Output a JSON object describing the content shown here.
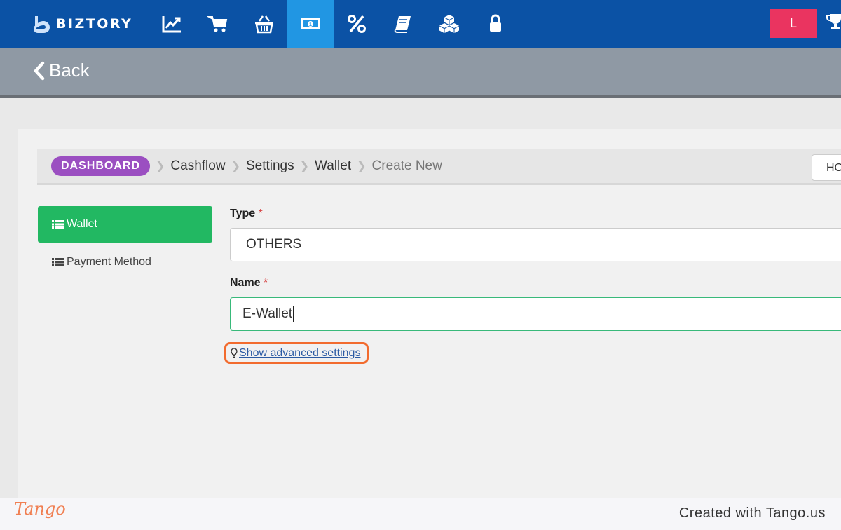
{
  "nav": {
    "brand": "BIZTORY",
    "icons": [
      "chart-line-icon",
      "cart-icon",
      "basket-icon",
      "money-icon",
      "percent-icon",
      "book-icon",
      "cubes-icon",
      "lock-icon"
    ],
    "active_icon": "money-icon",
    "user_initial": "L"
  },
  "back": {
    "label": "Back"
  },
  "breadcrumb": {
    "items": [
      "DASHBOARD",
      "Cashflow",
      "Settings",
      "Wallet",
      "Create New"
    ],
    "right_button_partial": "HO"
  },
  "sidebar": {
    "items": [
      {
        "label": "Wallet",
        "active": true
      },
      {
        "label": "Payment Method",
        "active": false
      }
    ]
  },
  "form": {
    "type_label": "Type",
    "type_value": "OTHERS",
    "name_label": "Name",
    "name_value": "E-Wallet",
    "required_marker": "*",
    "advanced_link": "Show advanced settings"
  },
  "footer": {
    "logo": "Tango",
    "created": "Created with Tango.us"
  },
  "colors": {
    "nav_bg": "#0b52a5",
    "nav_active": "#2196e3",
    "user_btn": "#ea3460",
    "back_bar": "#8f99a4",
    "dashboard_pill": "#9b4fc1",
    "sidebar_active": "#22b862",
    "highlight": "#f26b2e"
  }
}
